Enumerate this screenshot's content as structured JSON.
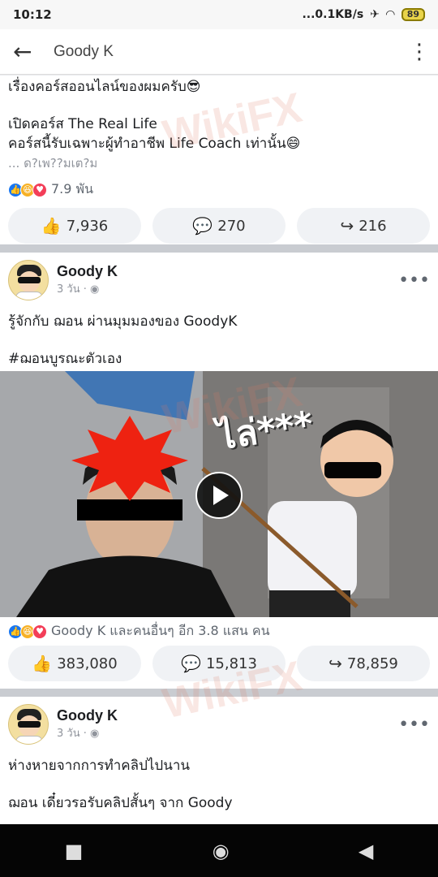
{
  "status": {
    "time": "10:12",
    "network": "...0.1KB/s",
    "battery": "89"
  },
  "appbar": {
    "title": "Goody K"
  },
  "post1": {
    "line1": "เรื่องคอร์สออนไลน์ของผมครับ😎",
    "line2": "เปิดคอร์ส The Real Life",
    "line3": "คอร์สนี้รับเฉพาะผู้ทำอาชีพ Life Coach เท่านั้น😄",
    "see_more": "... ด?เพ??มเต?ม",
    "reaction_count": "7.9 พัน",
    "likes": "7,936",
    "comments": "270",
    "shares": "216"
  },
  "post2": {
    "author": "Goody K",
    "time": "3 วัน ·",
    "line1": "รู้จักกับ ฌอน ผ่านมุมมองของ GoodyK",
    "line2": "#ฌอนบูรณะตัวเอง",
    "video_overlay": "ไล่***",
    "reaction_text": "Goody K และคนอื่นๆ อีก 3.8 แสน คน",
    "likes": "383,080",
    "comments": "15,813",
    "shares": "78,859"
  },
  "post3": {
    "author": "Goody K",
    "time": "3 วัน ·",
    "line1": "ห่างหายจากการทำคลิปไปนาน",
    "line2": "ฌอน เดี๋ยวรอรับคลิปสั้นๆ จาก Goody"
  },
  "watermark": "WikiFX"
}
